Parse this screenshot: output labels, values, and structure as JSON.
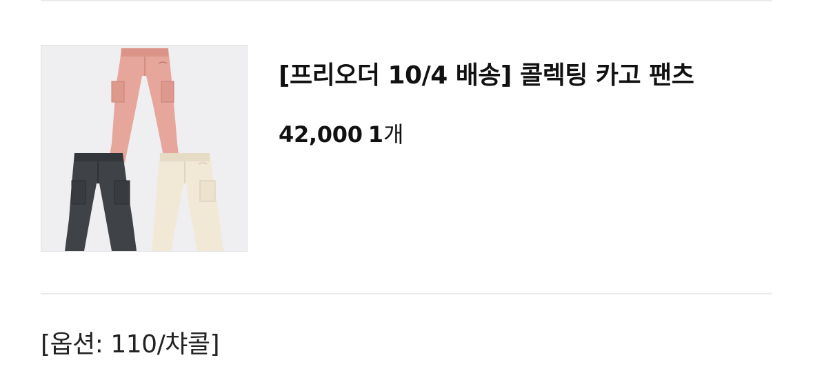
{
  "product": {
    "title": "[프리오더 10/4 배송] 콜렉팅 카고 팬츠",
    "price": "42,000",
    "quantity": "1",
    "quantity_unit": "개",
    "option_label": "[옵션: 110/챠콜]",
    "image_icon": "cargo-pants-photo",
    "variant_colors": [
      "#e7a69c",
      "#3f4347",
      "#f1e8d6"
    ]
  }
}
